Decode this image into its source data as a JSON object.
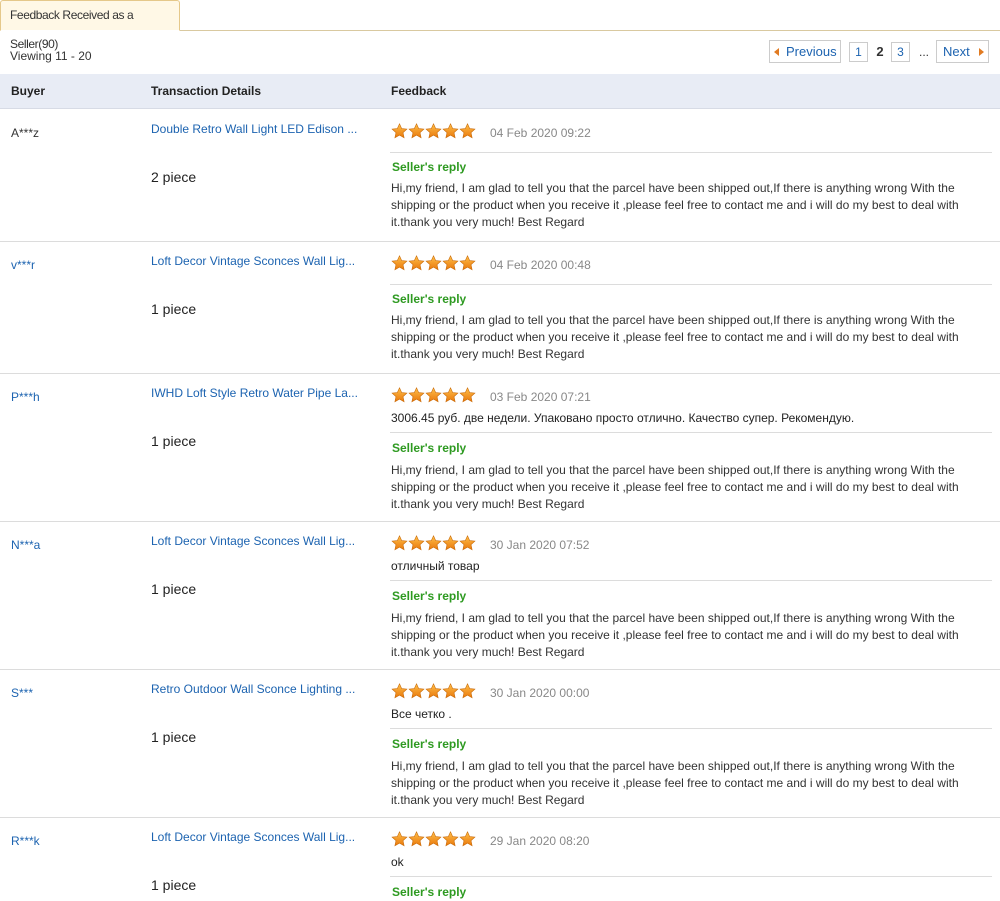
{
  "tab": {
    "label": "Feedback Received as a Seller(90)"
  },
  "viewing": "Viewing 11 - 20",
  "pager": {
    "prev": "Previous",
    "pages": [
      "1",
      "2",
      "3"
    ],
    "current": "2",
    "ellipsis": "...",
    "next": "Next"
  },
  "columns": {
    "buyer": "Buyer",
    "transaction": "Transaction Details",
    "feedback": "Feedback"
  },
  "reply_label": "Seller's reply",
  "reply_text": "Hi,my friend, I am glad to tell you that the parcel have been shipped out,If there is anything wrong With the shipping or the product when you receive it ,please feel free to contact me and i will do my best to deal with it.thank you very much! Best Regard",
  "colors": {
    "link": "#1c63b0",
    "reply": "#2e9a21",
    "star": "#f39c12"
  },
  "rows": [
    {
      "buyer": "A***z",
      "product": "Double Retro Wall Light LED Edison ...",
      "qty": "2 piece",
      "rating": 5,
      "date": "04 Feb 2020 09:22",
      "comment": ""
    },
    {
      "buyer": "v***r",
      "product": "Loft Decor Vintage Sconces Wall Lig...",
      "qty": "1 piece",
      "rating": 5,
      "date": "04 Feb 2020 00:48",
      "comment": ""
    },
    {
      "buyer": "P***h",
      "product": "IWHD Loft Style Retro Water Pipe La...",
      "qty": "1 piece",
      "rating": 5,
      "date": "03 Feb 2020 07:21",
      "comment": "3006.45 руб. две недели. Упаковано просто отлично. Качество супер. Рекомендую."
    },
    {
      "buyer": "N***a",
      "product": "Loft Decor Vintage Sconces Wall Lig...",
      "qty": "1 piece",
      "rating": 5,
      "date": "30 Jan 2020 07:52",
      "comment": "отличный товар"
    },
    {
      "buyer": "S***",
      "product": "Retro Outdoor Wall Sconce Lighting ...",
      "qty": "1 piece",
      "rating": 5,
      "date": "30 Jan 2020 00:00",
      "comment": "Все четко ."
    },
    {
      "buyer": "R***k",
      "product": "Loft Decor Vintage Sconces Wall Lig...",
      "qty": "1 piece",
      "rating": 5,
      "date": "29 Jan 2020 08:20",
      "comment": "ok"
    }
  ]
}
